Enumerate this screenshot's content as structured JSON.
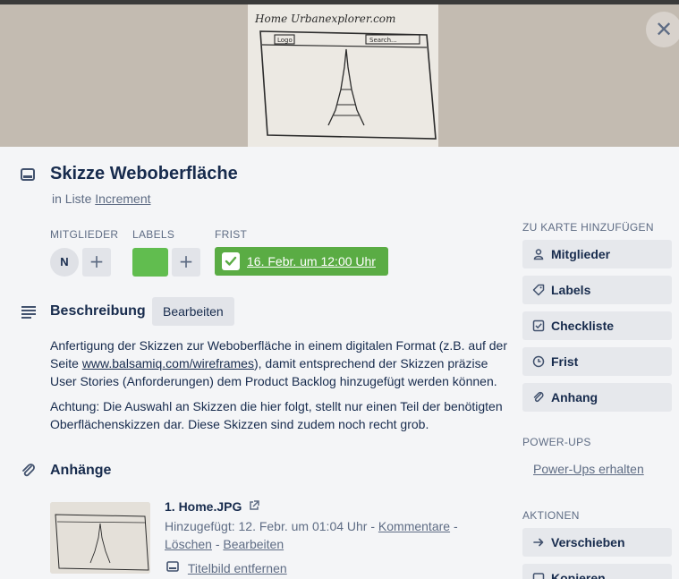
{
  "card": {
    "title": "Skizze Weboberfläche",
    "list_prefix": "in Liste",
    "list_name": "Increment"
  },
  "cover": {
    "close_label": "✕",
    "sketch_texts": [
      "Home Urbanexplorer.com",
      "Logo",
      "Search..."
    ]
  },
  "meta": {
    "members_label": "MITGLIEDER",
    "member_initial": "N",
    "labels_label": "LABELS",
    "label_color": "#61bd4f",
    "due_label": "FRIST",
    "due_value": "16. Febr. um 12:00 Uhr",
    "due_color": "#5aac44",
    "add_symbol": "+"
  },
  "description": {
    "title": "Beschreibung",
    "edit_label": "Bearbeiten",
    "p1_before": "Anfertigung der Skizzen zur Weboberfläche in einem digitalen Format (z.B. auf der Seite ",
    "p1_link": "www.balsamiq.com/wireframes",
    "p1_after": "), damit entsprechend der Skizzen präzise User Stories (Anforderungen) dem Product Backlog hinzugefügt werden können.",
    "p2": "Achtung: Die Auswahl an Skizzen die hier folgt, stellt nur einen Teil der benötigten Oberflächenskizzen dar. Diese Skizzen sind zudem noch recht grob."
  },
  "attachments": {
    "title": "Anhänge",
    "items": [
      {
        "name": "1. Home.JPG",
        "added_text": "Hinzugefügt: 12. Febr. um 01:04 Uhr -",
        "comments_label": "Kommentare",
        "separator": "-",
        "delete_label": "Löschen",
        "edit_label": "Bearbeiten",
        "remove_cover_label": "Titelbild entfernen"
      }
    ]
  },
  "sidebar": {
    "add_heading": "ZU KARTE HINZUFÜGEN",
    "add_buttons": [
      {
        "label": "Mitglieder",
        "icon": "person-icon"
      },
      {
        "label": "Labels",
        "icon": "tag-icon"
      },
      {
        "label": "Checkliste",
        "icon": "checklist-icon"
      },
      {
        "label": "Frist",
        "icon": "clock-icon"
      },
      {
        "label": "Anhang",
        "icon": "paperclip-icon"
      }
    ],
    "powerups_heading": "POWER-UPS",
    "powerups_link": "Power-Ups erhalten",
    "actions_heading": "AKTIONEN",
    "action_buttons": [
      {
        "label": "Verschieben",
        "icon": "arrow-right-icon"
      },
      {
        "label": "Kopieren",
        "icon": "card-icon"
      }
    ]
  }
}
